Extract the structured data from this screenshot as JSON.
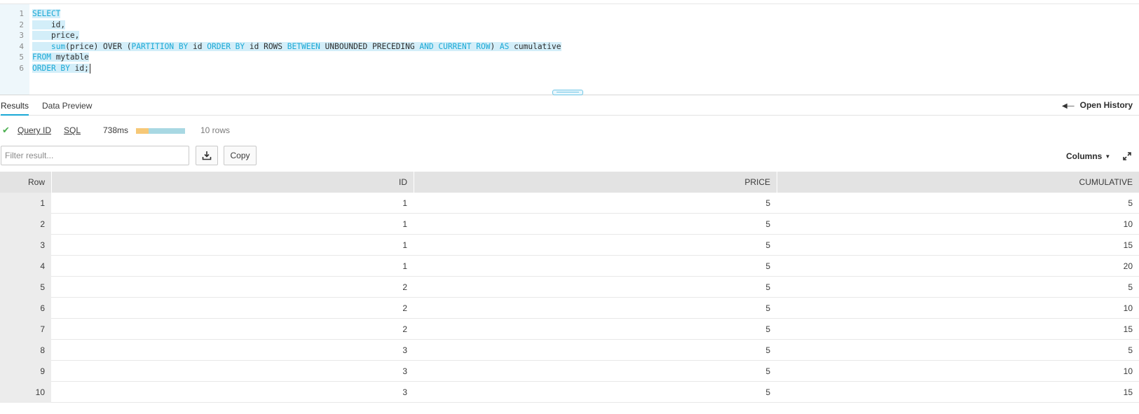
{
  "editor": {
    "line_numbers": [
      "1",
      "2",
      "3",
      "4",
      "5",
      "6"
    ],
    "lines": [
      [
        {
          "t": "SELECT",
          "k": 1
        }
      ],
      [
        {
          "t": "    id,",
          "k": 0
        }
      ],
      [
        {
          "t": "    price,",
          "k": 0
        }
      ],
      [
        {
          "t": "    ",
          "k": 0
        },
        {
          "t": "sum",
          "k": 1
        },
        {
          "t": "(price) OVER (",
          "k": 0
        },
        {
          "t": "PARTITION BY",
          "k": 1
        },
        {
          "t": " id ",
          "k": 0
        },
        {
          "t": "ORDER BY",
          "k": 1
        },
        {
          "t": " id ROWS ",
          "k": 0
        },
        {
          "t": "BETWEEN",
          "k": 1
        },
        {
          "t": " UNBOUNDED PRECEDING ",
          "k": 0
        },
        {
          "t": "AND",
          "k": 1
        },
        {
          "t": " ",
          "k": 0
        },
        {
          "t": "CURRENT ROW",
          "k": 1
        },
        {
          "t": ") ",
          "k": 0
        },
        {
          "t": "AS",
          "k": 1
        },
        {
          "t": " cumulative",
          "k": 0
        }
      ],
      [
        {
          "t": "FROM",
          "k": 1
        },
        {
          "t": " mytable",
          "k": 0
        }
      ],
      [
        {
          "t": "ORDER BY",
          "k": 1
        },
        {
          "t": " id;",
          "k": 0
        }
      ]
    ]
  },
  "tabs": {
    "results": "Results",
    "data_preview": "Data Preview",
    "open_history": "Open History"
  },
  "status": {
    "query_id": "Query ID",
    "sql": "SQL",
    "time": "738ms",
    "progress_split": 0.25,
    "rows": "10 rows"
  },
  "toolbar": {
    "filter_placeholder": "Filter result...",
    "copy_label": "Copy",
    "columns_label": "Columns"
  },
  "table": {
    "headers": [
      "Row",
      "ID",
      "PRICE",
      "CUMULATIVE"
    ],
    "rows": [
      [
        "1",
        "1",
        "5",
        "5"
      ],
      [
        "2",
        "1",
        "5",
        "10"
      ],
      [
        "3",
        "1",
        "5",
        "15"
      ],
      [
        "4",
        "1",
        "5",
        "20"
      ],
      [
        "5",
        "2",
        "5",
        "5"
      ],
      [
        "6",
        "2",
        "5",
        "10"
      ],
      [
        "7",
        "2",
        "5",
        "15"
      ],
      [
        "8",
        "3",
        "5",
        "5"
      ],
      [
        "9",
        "3",
        "5",
        "10"
      ],
      [
        "10",
        "3",
        "5",
        "15"
      ]
    ]
  },
  "colors": {
    "keyword": "#1aa9d6",
    "selection": "#d3eef9",
    "success": "#4caf50",
    "bar_fast": "#f6c877",
    "bar_rest": "#a8d8e3"
  }
}
